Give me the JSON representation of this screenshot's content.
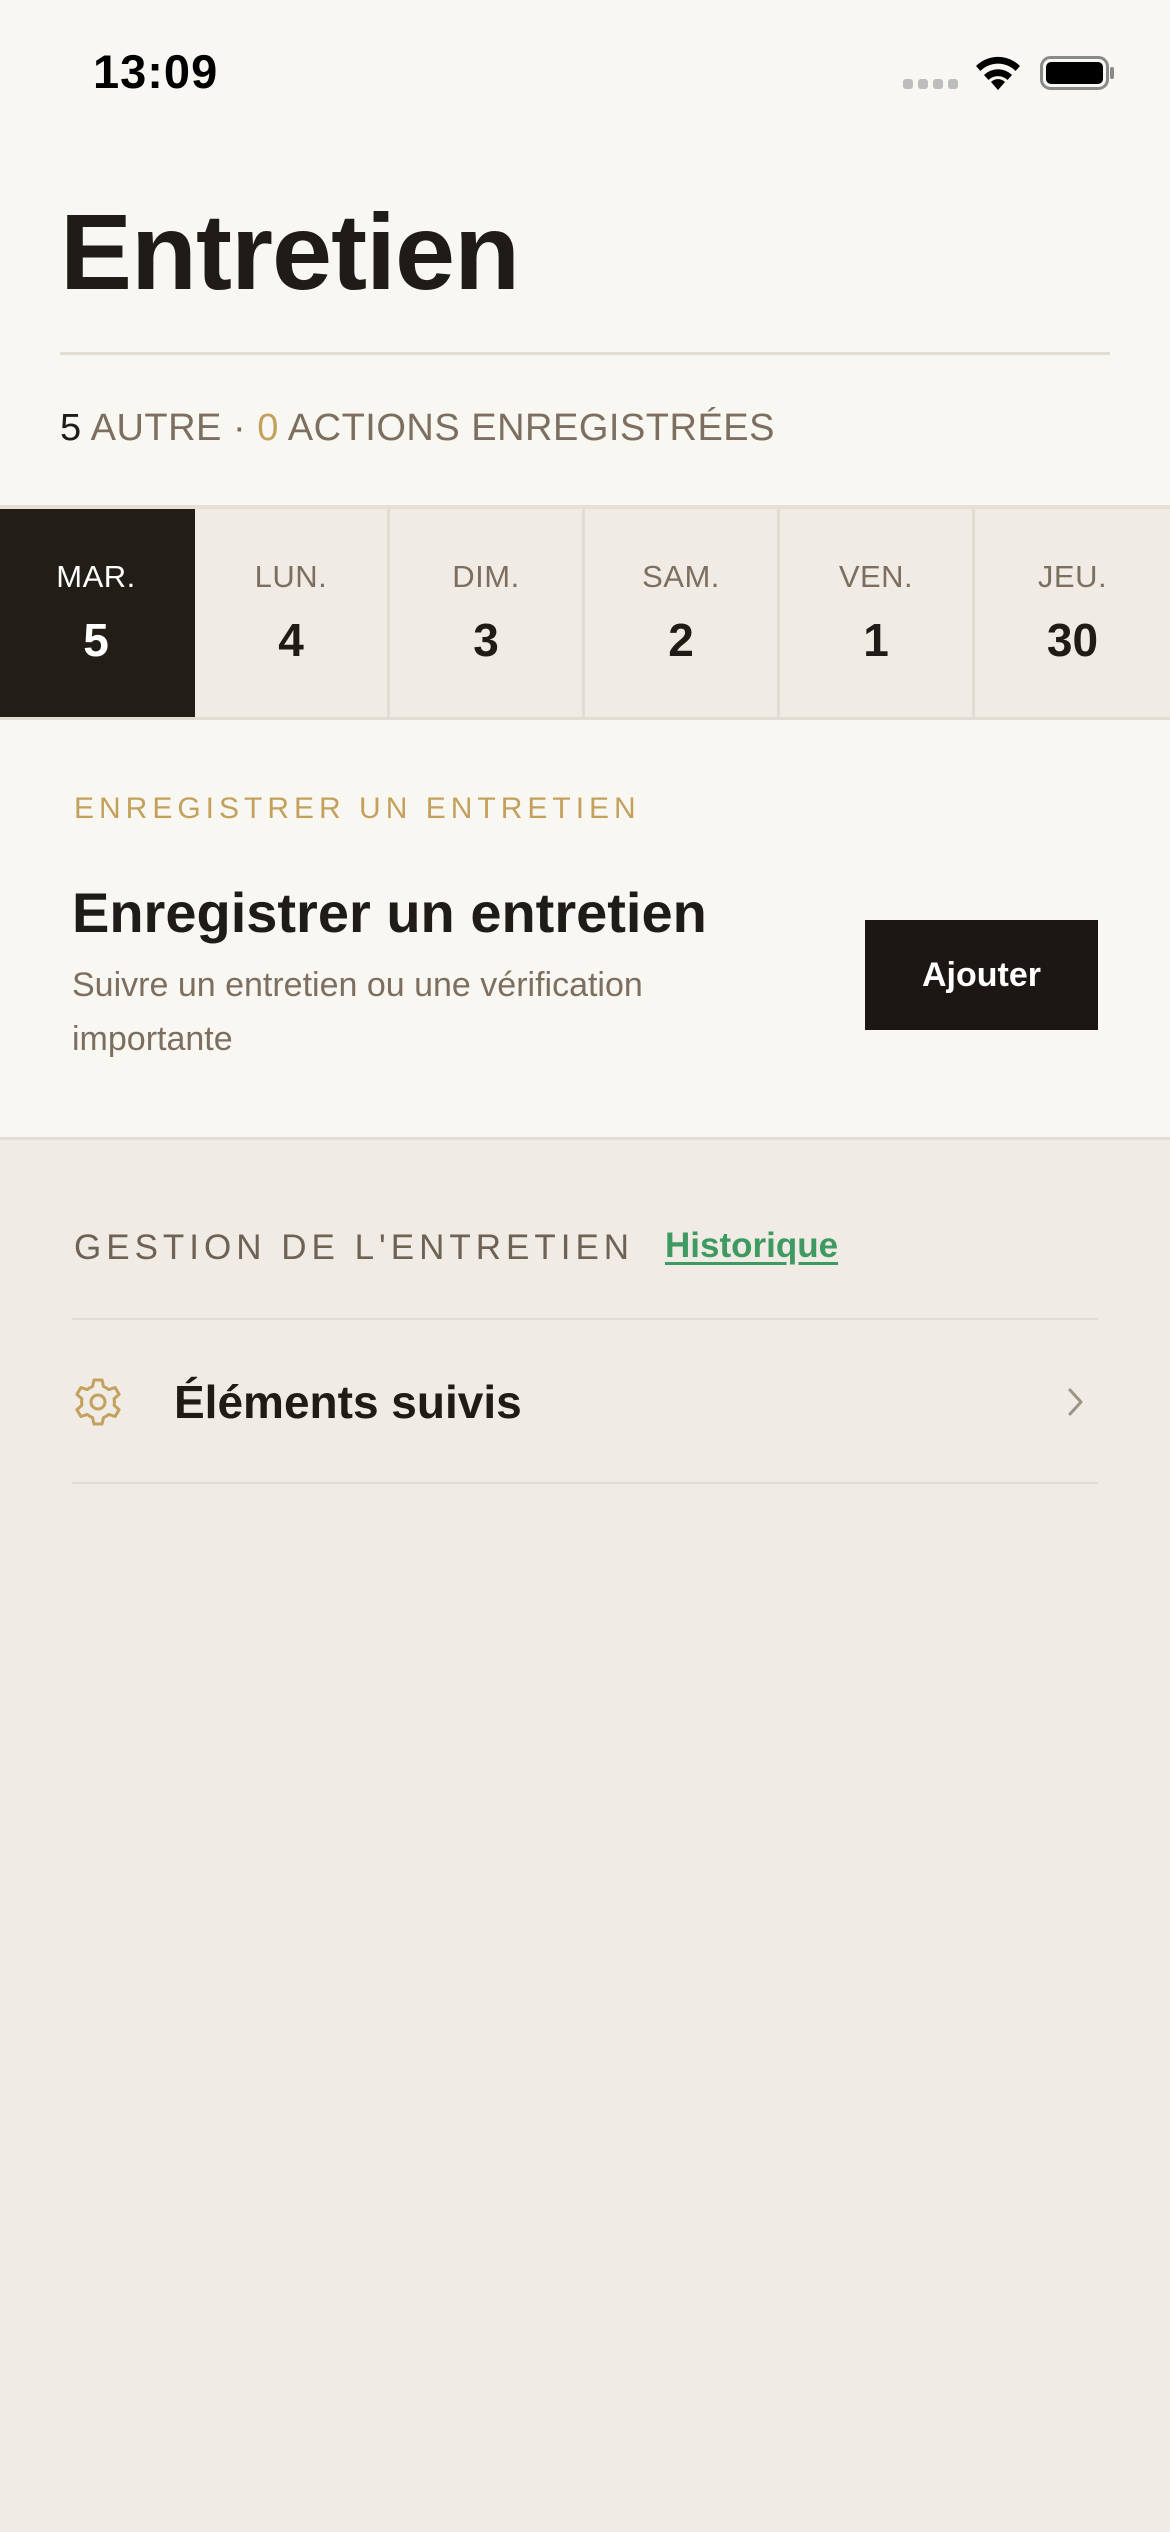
{
  "status_bar": {
    "time": "13:09"
  },
  "header": {
    "title": "Entretien",
    "summary": {
      "count_other": "5",
      "other_label": "AUTRE",
      "separator": "·",
      "count_actions": "0",
      "actions_label": "ACTIONS ENREGISTRÉES"
    }
  },
  "days": [
    {
      "name": "MAR.",
      "num": "5",
      "selected": true
    },
    {
      "name": "LUN.",
      "num": "4",
      "selected": false
    },
    {
      "name": "DIM.",
      "num": "3",
      "selected": false
    },
    {
      "name": "SAM.",
      "num": "2",
      "selected": false
    },
    {
      "name": "VEN.",
      "num": "1",
      "selected": false
    },
    {
      "name": "JEU.",
      "num": "30",
      "selected": false
    }
  ],
  "register_card": {
    "eyebrow": "ENREGISTRER UN ENTRETIEN",
    "heading": "Enregistrer un entretien",
    "description": "Suivre un entretien ou une vérification importante",
    "button_label": "Ajouter"
  },
  "management": {
    "section_label": "GESTION DE L'ENTRETIEN",
    "history_link": "Historique",
    "items": [
      {
        "label": "Éléments suivis",
        "icon": "gear-icon"
      }
    ]
  },
  "colors": {
    "accent_gold": "#c3a15d",
    "link_green": "#3f9a62",
    "dark": "#1f1b16",
    "selected_day_bg": "#221d16"
  }
}
